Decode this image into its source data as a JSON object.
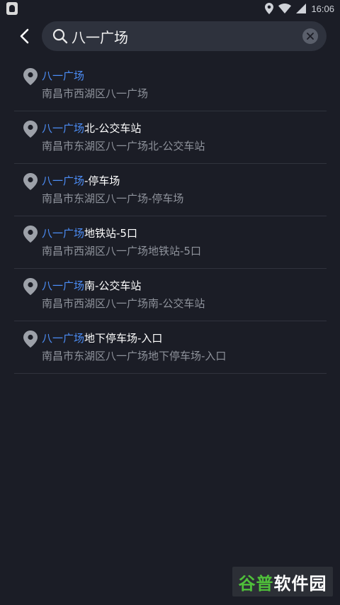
{
  "status_bar": {
    "time": "16:06"
  },
  "search": {
    "query": "八一广场",
    "icon": "search-icon"
  },
  "colors": {
    "background": "#1b1d26",
    "highlight": "#4c8df6",
    "search_box": "#2e323d",
    "secondary_text": "#8f939c"
  },
  "results": [
    {
      "title_highlight": "八一广场",
      "title_rest": "",
      "address": "南昌市西湖区八一广场"
    },
    {
      "title_highlight": "八一广场",
      "title_rest": "北-公交车站",
      "address": "南昌市东湖区八一广场北-公交车站"
    },
    {
      "title_highlight": "八一广场",
      "title_rest": "-停车场",
      "address": "南昌市东湖区八一广场-停车场"
    },
    {
      "title_highlight": "八一广场",
      "title_rest": "地铁站-5口",
      "address": "南昌市西湖区八一广场地铁站-5口"
    },
    {
      "title_highlight": "八一广场",
      "title_rest": "南-公交车站",
      "address": "南昌市西湖区八一广场南-公交车站"
    },
    {
      "title_highlight": "八一广场",
      "title_rest": "地下停车场-入口",
      "address": "南昌市东湖区八一广场地下停车场-入口"
    }
  ],
  "watermark": {
    "part1": "谷普",
    "part2": "软件园"
  }
}
